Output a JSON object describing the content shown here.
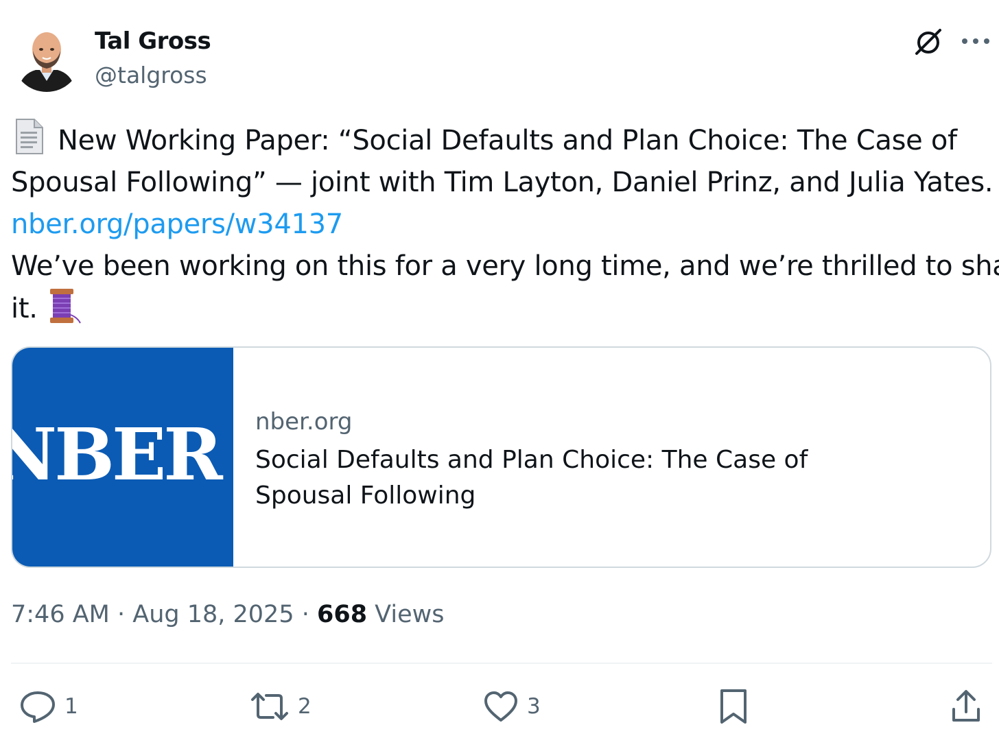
{
  "author": {
    "name": "Tal Gross",
    "handle": "@talgross"
  },
  "tweet": {
    "lines": [
      "New Working Paper: “Social Defaults and Plan Choice: The Case of",
      "Spousal Following” — joint with Tim Layton, Daniel Prinz, and Julia Yates.",
      "nber.org/papers/w34137",
      "We’ve been working on this for a very long time, and we’re thrilled to share",
      "it."
    ],
    "emojis": [
      "page-facing-up",
      "thread-spool"
    ]
  },
  "card": {
    "logo_text": "NBER",
    "domain": "nber.org",
    "title": "Social Defaults and Plan Choice: The Case of Spousal Following"
  },
  "meta": {
    "time": "7:46 AM",
    "separator": " · ",
    "date": "Aug 18, 2025",
    "views_count": "668",
    "views_label": " Views"
  },
  "actions": {
    "replies": "1",
    "reposts": "2",
    "likes": "3"
  },
  "colors": {
    "link": "#1d9bf0",
    "secondary_text": "#536471",
    "card_logo_bg": "#0b5bb4",
    "border": "#cfd9de"
  },
  "icons": [
    "grok-icon",
    "more-icon",
    "reply-icon",
    "repost-icon",
    "like-icon",
    "bookmark-icon",
    "share-icon"
  ]
}
